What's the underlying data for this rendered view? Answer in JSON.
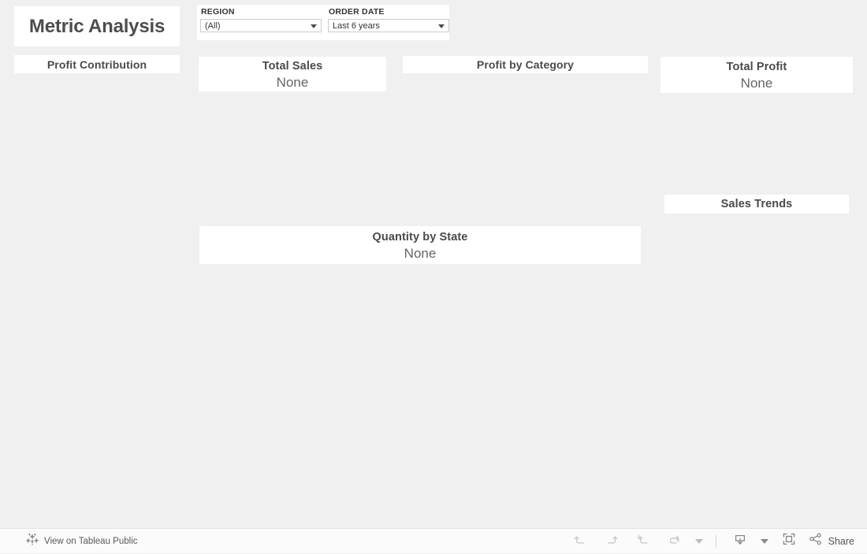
{
  "dashboard": {
    "title": "Metric Analysis",
    "background_color": "#f0f0f0",
    "panel_color": "#ffffff",
    "text_color": "#4a4a4a"
  },
  "filters": [
    {
      "label": "REGION",
      "value": "(All)",
      "icon": "chevron-down-icon"
    },
    {
      "label": "ORDER DATE",
      "value": "Last 6 years",
      "icon": "chevron-down-icon"
    }
  ],
  "worksheets": {
    "profit_contribution": {
      "title": "Profit Contribution",
      "value": ""
    },
    "total_sales": {
      "title": "Total Sales",
      "value": "None"
    },
    "profit_by_category": {
      "title": "Profit by Category",
      "value": ""
    },
    "total_profit": {
      "title": "Total Profit",
      "value": "None"
    },
    "sales_trends": {
      "title": "Sales Trends",
      "value": ""
    },
    "quantity_by_state": {
      "title": "Quantity by State",
      "value": "None"
    }
  },
  "toolbar": {
    "tableau_public_link": {
      "label": "View on Tableau Public",
      "icon": "tableau-logo-icon"
    },
    "buttons": [
      {
        "name": "undo",
        "icon": "undo-icon"
      },
      {
        "name": "redo",
        "icon": "redo-icon"
      },
      {
        "name": "revert",
        "icon": "revert-icon"
      },
      {
        "name": "refresh",
        "icon": "refresh-icon"
      },
      {
        "name": "refresh-menu",
        "icon": "caret-down-icon"
      },
      {
        "name": "download",
        "icon": "download-icon"
      },
      {
        "name": "download-menu",
        "icon": "caret-down-icon"
      },
      {
        "name": "fullscreen",
        "icon": "fullscreen-icon"
      }
    ],
    "share": {
      "label": "Share",
      "icon": "share-nodes-icon"
    }
  }
}
